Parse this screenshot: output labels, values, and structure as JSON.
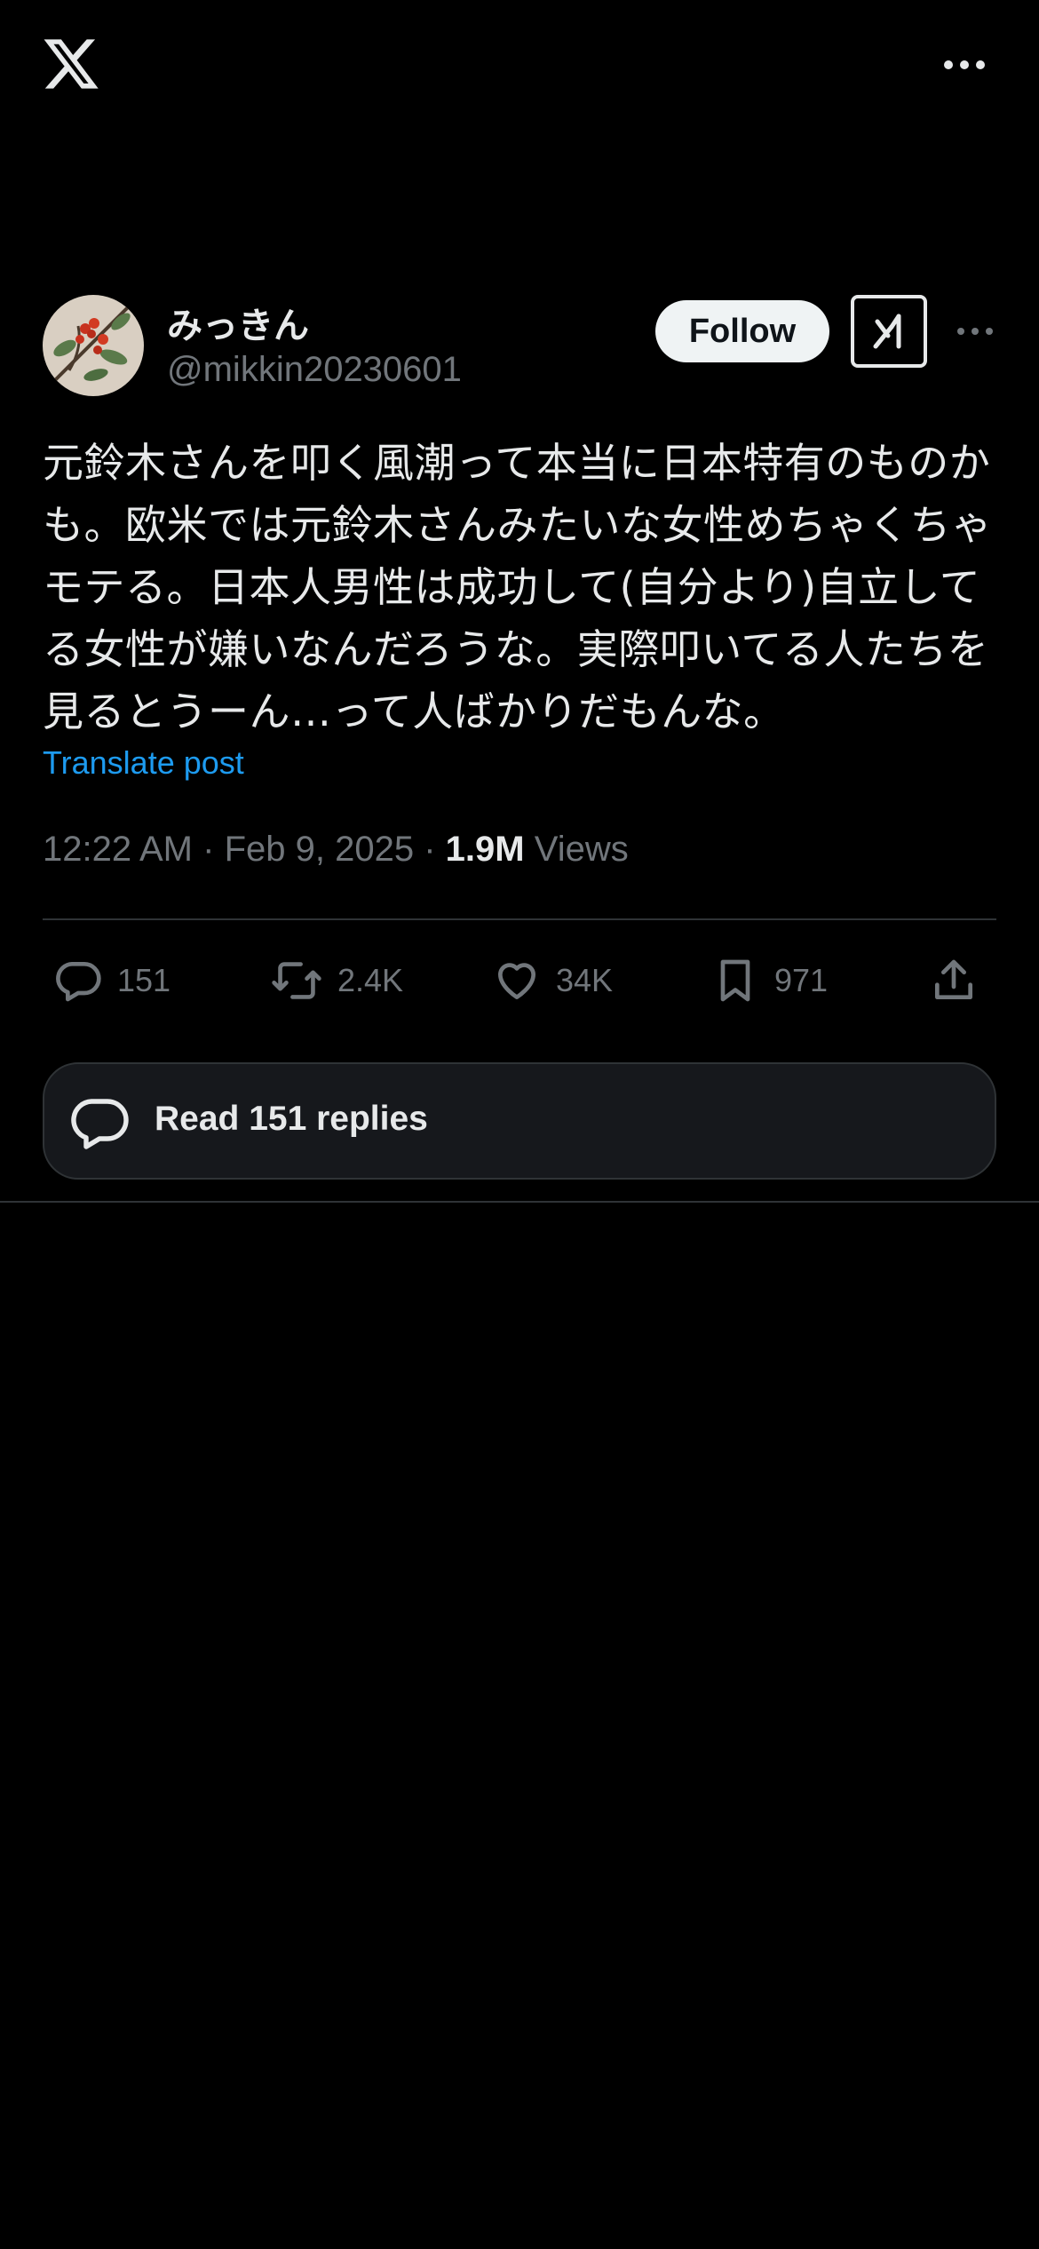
{
  "colors": {
    "background": "#000000",
    "text_primary": "#e7e9ea",
    "text_secondary": "#71767b",
    "link": "#1d9bf0",
    "divider": "#2f3336",
    "follow_button_bg": "#eff3f4"
  },
  "topbar": {
    "logo_icon": "x-logo-icon",
    "more_icon": "more-horizontal-icon"
  },
  "author": {
    "display_name": "みっきん",
    "handle": "@mikkin20230601",
    "avatar_icon": "avatar-berries-image"
  },
  "header_actions": {
    "follow_label": "Follow",
    "grok_icon": "grok-icon",
    "more_icon": "more-horizontal-icon"
  },
  "tweet": {
    "text": "元鈴木さんを叩く風潮って本当に日本特有のものかも。欧米では元鈴木さんみたいな女性めちゃくちゃモテる。日本人男性は成功して(自分より)自立してる女性が嫌いなんだろうな。実際叩いてる人たちを見るとうーん…って人ばかりだもんな。",
    "translate_label": "Translate post",
    "time": "12:22 AM",
    "date": "Feb 9, 2025",
    "separator": "·",
    "views_count": "1.9M",
    "views_label": "Views"
  },
  "actions": {
    "replies": "151",
    "reposts": "2.4K",
    "likes": "34K",
    "bookmarks": "971",
    "reply_icon": "reply-icon",
    "repost_icon": "repost-icon",
    "like_icon": "heart-icon",
    "bookmark_icon": "bookmark-icon",
    "share_icon": "share-icon"
  },
  "read_replies": {
    "label": "Read 151 replies",
    "icon": "chat-bubble-icon"
  }
}
